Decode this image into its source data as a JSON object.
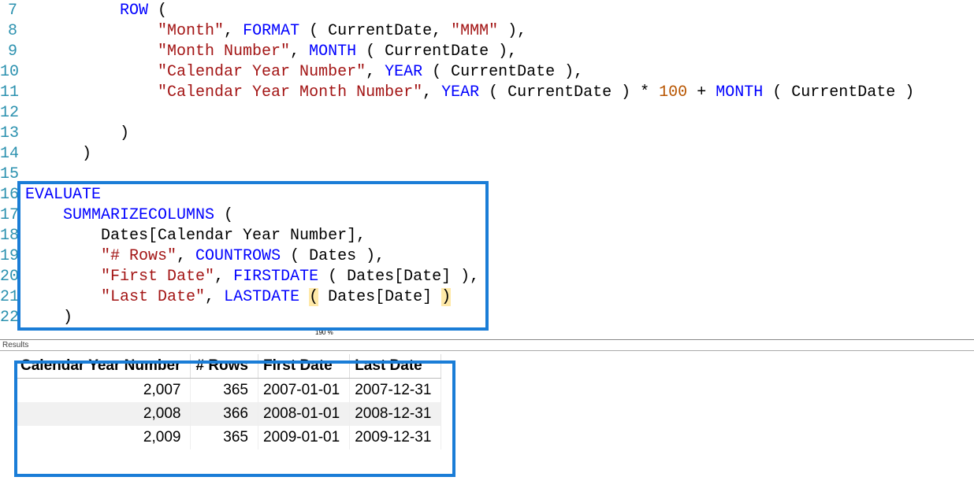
{
  "zoom": "190 %",
  "lines": [
    {
      "n": 7,
      "tokens": [
        {
          "t": "          ",
          "c": "plain"
        },
        {
          "t": "ROW",
          "c": "kw"
        },
        {
          "t": " (",
          "c": "plain"
        }
      ]
    },
    {
      "n": 8,
      "tokens": [
        {
          "t": "              ",
          "c": "plain"
        },
        {
          "t": "\"Month\"",
          "c": "str"
        },
        {
          "t": ", ",
          "c": "plain"
        },
        {
          "t": "FORMAT",
          "c": "kw"
        },
        {
          "t": " ( CurrentDate, ",
          "c": "plain"
        },
        {
          "t": "\"MMM\"",
          "c": "str"
        },
        {
          "t": " ),",
          "c": "plain"
        }
      ]
    },
    {
      "n": 9,
      "tokens": [
        {
          "t": "              ",
          "c": "plain"
        },
        {
          "t": "\"Month Number\"",
          "c": "str"
        },
        {
          "t": ", ",
          "c": "plain"
        },
        {
          "t": "MONTH",
          "c": "kw"
        },
        {
          "t": " ( CurrentDate ),",
          "c": "plain"
        }
      ]
    },
    {
      "n": 10,
      "tokens": [
        {
          "t": "              ",
          "c": "plain"
        },
        {
          "t": "\"Calendar Year Number\"",
          "c": "str"
        },
        {
          "t": ", ",
          "c": "plain"
        },
        {
          "t": "YEAR",
          "c": "kw"
        },
        {
          "t": " ( CurrentDate ),",
          "c": "plain"
        }
      ]
    },
    {
      "n": 11,
      "tokens": [
        {
          "t": "              ",
          "c": "plain"
        },
        {
          "t": "\"Calendar Year Month Number\"",
          "c": "str"
        },
        {
          "t": ", ",
          "c": "plain"
        },
        {
          "t": "YEAR",
          "c": "kw"
        },
        {
          "t": " ( CurrentDate ) * ",
          "c": "plain"
        },
        {
          "t": "100",
          "c": "num"
        },
        {
          "t": " + ",
          "c": "plain"
        },
        {
          "t": "MONTH",
          "c": "kw"
        },
        {
          "t": " ( CurrentDate )",
          "c": "plain"
        }
      ]
    },
    {
      "n": 12,
      "tokens": [
        {
          "t": " ",
          "c": "plain"
        }
      ]
    },
    {
      "n": 13,
      "tokens": [
        {
          "t": "          )",
          "c": "plain"
        }
      ]
    },
    {
      "n": 14,
      "tokens": [
        {
          "t": "      )",
          "c": "plain"
        }
      ]
    },
    {
      "n": 15,
      "tokens": [
        {
          "t": " ",
          "c": "plain"
        }
      ]
    },
    {
      "n": 16,
      "tokens": [
        {
          "t": "EVALUATE",
          "c": "kw"
        }
      ]
    },
    {
      "n": 17,
      "tokens": [
        {
          "t": "    ",
          "c": "plain"
        },
        {
          "t": "SUMMARIZECOLUMNS",
          "c": "kw"
        },
        {
          "t": " (",
          "c": "plain"
        }
      ]
    },
    {
      "n": 18,
      "tokens": [
        {
          "t": "        Dates[Calendar Year Number],",
          "c": "plain"
        }
      ]
    },
    {
      "n": 19,
      "tokens": [
        {
          "t": "        ",
          "c": "plain"
        },
        {
          "t": "\"# Rows\"",
          "c": "str"
        },
        {
          "t": ", ",
          "c": "plain"
        },
        {
          "t": "COUNTROWS",
          "c": "kw"
        },
        {
          "t": " ( Dates ),",
          "c": "plain"
        }
      ]
    },
    {
      "n": 20,
      "tokens": [
        {
          "t": "        ",
          "c": "plain"
        },
        {
          "t": "\"First Date\"",
          "c": "str"
        },
        {
          "t": ", ",
          "c": "plain"
        },
        {
          "t": "FIRSTDATE",
          "c": "kw"
        },
        {
          "t": " ( Dates[Date] ),",
          "c": "plain"
        }
      ]
    },
    {
      "n": 21,
      "tokens": [
        {
          "t": "        ",
          "c": "plain"
        },
        {
          "t": "\"Last Date\"",
          "c": "str"
        },
        {
          "t": ", ",
          "c": "plain"
        },
        {
          "t": "LASTDATE",
          "c": "kw"
        },
        {
          "t": " ",
          "c": "plain"
        },
        {
          "t": "(",
          "c": "brmatch"
        },
        {
          "t": " Dates[Date] ",
          "c": "plain"
        },
        {
          "t": ")",
          "c": "brmatch"
        }
      ]
    },
    {
      "n": 22,
      "tokens": [
        {
          "t": "    )",
          "c": "plain"
        }
      ]
    }
  ],
  "results": {
    "label": "Results",
    "headers": [
      "Calendar Year Number",
      "# Rows",
      "First Date",
      "Last Date"
    ],
    "numeric": [
      true,
      true,
      false,
      false
    ],
    "rows": [
      [
        "2,007",
        "365",
        "2007-01-01",
        "2007-12-31"
      ],
      [
        "2,008",
        "366",
        "2008-01-01",
        "2008-12-31"
      ],
      [
        "2,009",
        "365",
        "2009-01-01",
        "2009-12-31"
      ]
    ]
  }
}
